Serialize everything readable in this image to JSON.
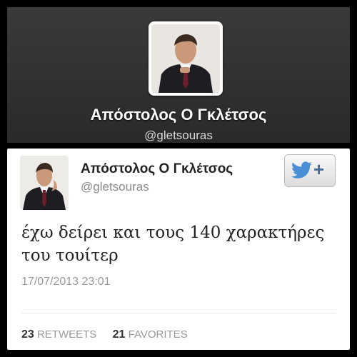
{
  "profile": {
    "name": "Απόστολος Ο Γκλέτσος",
    "handle": "@gletsouras"
  },
  "tweet": {
    "name": "Απόστολος Ο Γκλέτσος",
    "handle": "@gletsouras",
    "follow_plus": "+",
    "text": "έχω δείρει και τους 140 χαρακτήρες του τουίτερ",
    "timestamp": "17/07/2013 23:01",
    "retweets_count": "23",
    "retweets_label": "RETWEETS",
    "favorites_count": "21",
    "favorites_label": "FAVORITES"
  },
  "colors": {
    "header_bg": "#333333",
    "twitter_blue": "#4a8fd6",
    "muted_text": "#999999"
  },
  "icons": [
    "twitter-bird-icon"
  ]
}
